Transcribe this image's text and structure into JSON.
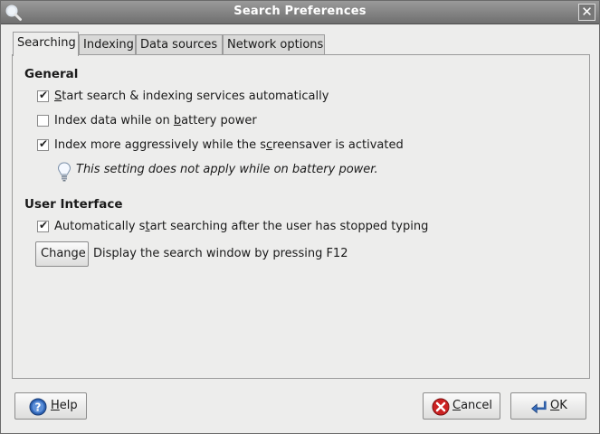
{
  "window": {
    "title": "Search Preferences"
  },
  "tabs": [
    {
      "label": "Searching",
      "active": true
    },
    {
      "label": "Indexing",
      "active": false
    },
    {
      "label": "Data sources",
      "active": false
    },
    {
      "label": "Network options",
      "active": false
    }
  ],
  "general": {
    "title": "General",
    "options": [
      {
        "pre": "",
        "mnemonic": "S",
        "post": "tart search & indexing services automatically",
        "checked": true
      },
      {
        "pre": "Index data while on ",
        "mnemonic": "b",
        "post": "attery power",
        "checked": false
      },
      {
        "pre": "Index more aggressively while the s",
        "mnemonic": "c",
        "post": "reensaver is activated",
        "checked": true
      }
    ],
    "hint": "This setting does not apply while on battery power."
  },
  "user_interface": {
    "title": "User Interface",
    "options": [
      {
        "pre": "Automatically s",
        "mnemonic": "t",
        "post": "art searching after the user has stopped typing",
        "checked": true
      }
    ],
    "change_button": "Change",
    "shortcut_description": "Display the search window by pressing F12"
  },
  "buttons": {
    "help": {
      "mnemonic": "H",
      "rest": "elp"
    },
    "cancel": {
      "mnemonic": "C",
      "rest": "ancel"
    },
    "ok": {
      "mnemonic": "O",
      "rest": "K"
    }
  },
  "icons": {
    "window": "search-magnifier-icon",
    "close": "close-icon",
    "hint": "lightbulb-icon",
    "help": "help-icon",
    "cancel": "cancel-icon",
    "ok": "ok-arrow-icon"
  }
}
